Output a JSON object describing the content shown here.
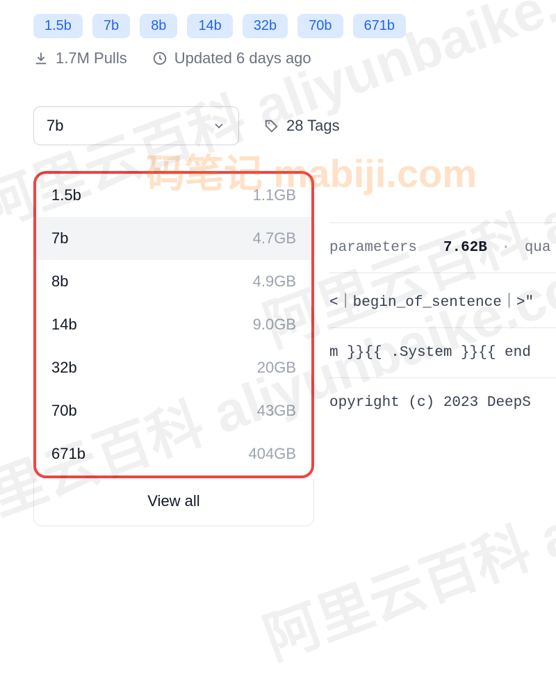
{
  "chips": [
    "1.5b",
    "7b",
    "8b",
    "14b",
    "32b",
    "70b",
    "671b"
  ],
  "meta": {
    "pulls": "1.7M Pulls",
    "updated": "Updated 6 days ago"
  },
  "selector": {
    "current": "7b",
    "tags_label": "28 Tags"
  },
  "dropdown": {
    "items": [
      {
        "name": "1.5b",
        "size": "1.1GB"
      },
      {
        "name": "7b",
        "size": "4.7GB",
        "selected": true
      },
      {
        "name": "8b",
        "size": "4.9GB"
      },
      {
        "name": "14b",
        "size": "9.0GB"
      },
      {
        "name": "32b",
        "size": "20GB"
      },
      {
        "name": "70b",
        "size": "43GB"
      },
      {
        "name": "671b",
        "size": "404GB"
      }
    ],
    "view_all": "View all"
  },
  "info_rows": {
    "params_label": "parameters",
    "params_value": "7.62B",
    "params_tail": "qua",
    "template_head": "<｜begin_of_sentence｜>\"",
    "system_line": "m }}{{ .System }}{{ end",
    "copyright": "opyright (c) 2023 DeepS"
  },
  "watermarks": {
    "gray": "阿里云百科 aliyunbaike.com",
    "orange": "码笔记 mabiji.com"
  }
}
